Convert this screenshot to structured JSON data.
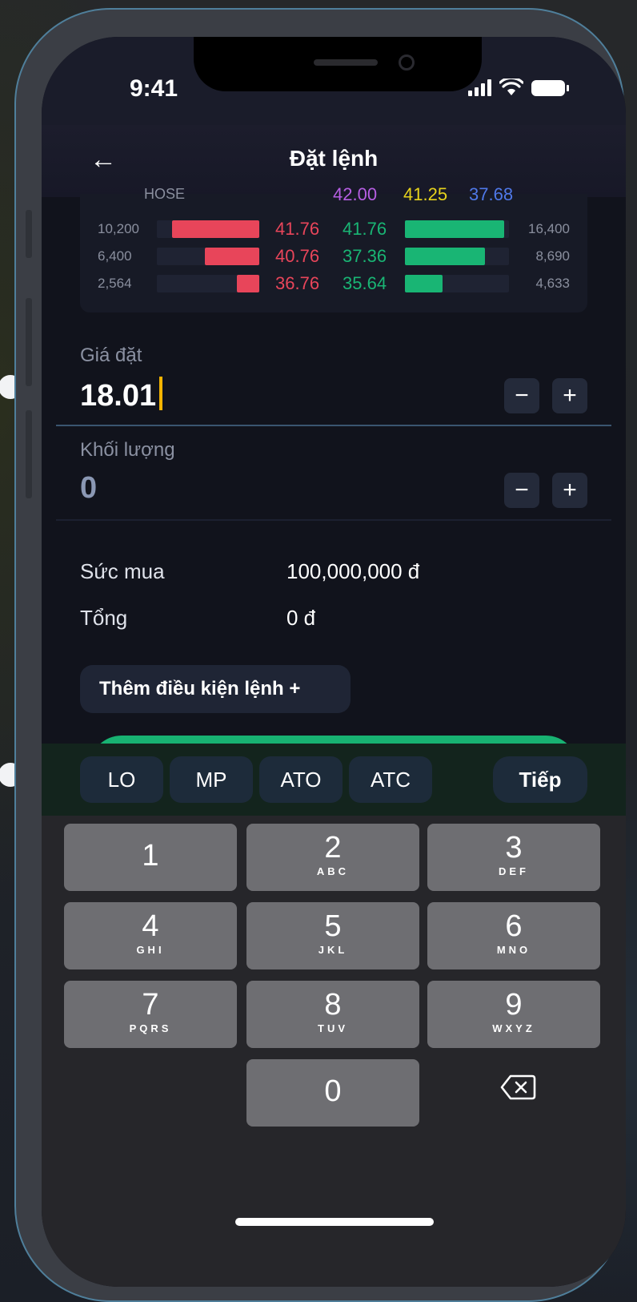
{
  "status_bar": {
    "time": "9:41"
  },
  "header": {
    "title": "Đặt lệnh"
  },
  "order_book": {
    "header_cut": {
      "exchange": "HOSE",
      "p1": "42.00",
      "p2": "41.25",
      "p3": "37.68"
    },
    "rows": [
      {
        "bid_vol": "10,200",
        "bid_price": "41.76",
        "ask_price": "41.76",
        "ask_vol": "16,400",
        "bid_fill": 0.85,
        "ask_fill": 0.95
      },
      {
        "bid_vol": "6,400",
        "bid_price": "40.76",
        "ask_price": "37.36",
        "ask_vol": "8,690",
        "bid_fill": 0.53,
        "ask_fill": 0.77
      },
      {
        "bid_vol": "2,564",
        "bid_price": "36.76",
        "ask_price": "35.64",
        "ask_vol": "4,633",
        "bid_fill": 0.22,
        "ask_fill": 0.36
      }
    ]
  },
  "price_field": {
    "label": "Giá đặt",
    "value": "18.01"
  },
  "quantity_field": {
    "label": "Khối lượng",
    "value": "0"
  },
  "stepper": {
    "minus": "−",
    "plus": "+"
  },
  "summary": {
    "buying_power_label": "Sức mua",
    "buying_power_value": "100,000,000 đ",
    "total_label": "Tổng",
    "total_value": "0 đ"
  },
  "add_condition": {
    "label": "Thêm điều kiện lệnh  +"
  },
  "quick_types": {
    "lo": "LO",
    "mp": "MP",
    "ato": "ATO",
    "atc": "ATC",
    "next": "Tiếp"
  },
  "keypad": {
    "k1": {
      "digit": "1",
      "letters": ""
    },
    "k2": {
      "digit": "2",
      "letters": "ABC"
    },
    "k3": {
      "digit": "3",
      "letters": "DEF"
    },
    "k4": {
      "digit": "4",
      "letters": "GHI"
    },
    "k5": {
      "digit": "5",
      "letters": "JKL"
    },
    "k6": {
      "digit": "6",
      "letters": "MNO"
    },
    "k7": {
      "digit": "7",
      "letters": "PQRS"
    },
    "k8": {
      "digit": "8",
      "letters": "TUV"
    },
    "k9": {
      "digit": "9",
      "letters": "WXYZ"
    },
    "k0": {
      "digit": "0",
      "letters": ""
    }
  },
  "colors": {
    "bid_red": "#e8455a",
    "ask_green": "#19b574",
    "caret": "#f5b400",
    "p1_purple": "#b65ee3",
    "p2_yellow": "#e6d21c",
    "p3_blue": "#4f78e8"
  }
}
